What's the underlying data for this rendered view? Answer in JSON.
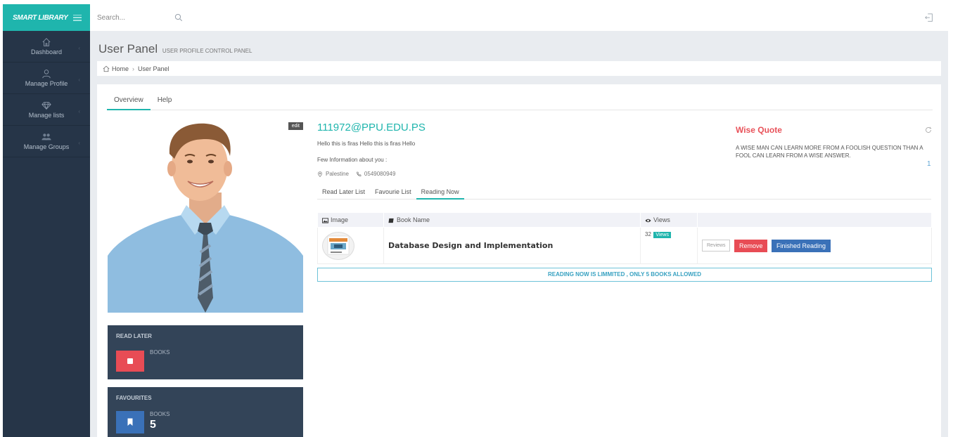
{
  "app": {
    "brand": "SMART LIBRARY"
  },
  "sidebar": {
    "items": [
      {
        "label": "Dashboard",
        "icon": "home-icon"
      },
      {
        "label": "Manage Profile",
        "icon": "user-icon"
      },
      {
        "label": "Manage lists",
        "icon": "diamond-icon"
      },
      {
        "label": "Manage Groups",
        "icon": "group-icon"
      }
    ]
  },
  "topbar": {
    "search_placeholder": "Search..."
  },
  "page": {
    "title": "User Panel",
    "subtitle": "USER PROFILE CONTROL PANEL"
  },
  "breadcrumb": {
    "home": "Home",
    "current": "User Panel"
  },
  "tabs": [
    "Overview",
    "Help"
  ],
  "profile": {
    "edit_label": "edit",
    "email": "111972@PPU.EDU.PS",
    "bio": "Hello this is firas Hello this is firas Hello",
    "few_info": "Few Information about you :",
    "location": "Palestine",
    "phone": "0549080949"
  },
  "stats": {
    "read_later": {
      "title": "READ LATER",
      "label": "BOOKS",
      "count": ""
    },
    "favourites": {
      "title": "FAVOURITES",
      "label": "BOOKS",
      "count": "5"
    }
  },
  "subtabs": [
    "Read Later List",
    "Favourie List",
    "Reading Now"
  ],
  "table": {
    "headers": [
      "Image",
      "Book Name",
      "Views"
    ],
    "rows": [
      {
        "book_name": "Database Design and Implementation",
        "views": "32",
        "views_badge": "Views"
      }
    ],
    "buttons": {
      "reviews": "Reviews",
      "remove": "Remove",
      "finished": "Finished Reading"
    }
  },
  "alert": "READING NOW IS LIMMITED , ONLY 5 BOOKS ALLOWED",
  "quote": {
    "title": "Wise Quote",
    "text": "A WISE MAN CAN LEARN MORE FROM A FOOLISH QUESTION THAN A FOOL CAN LEARN FROM A WISE ANSWER.",
    "number": "1"
  },
  "colors": {
    "accent": "#1fb5ad",
    "sidebar": "#263548",
    "danger": "#e84c55",
    "primary": "#3a71b8"
  }
}
